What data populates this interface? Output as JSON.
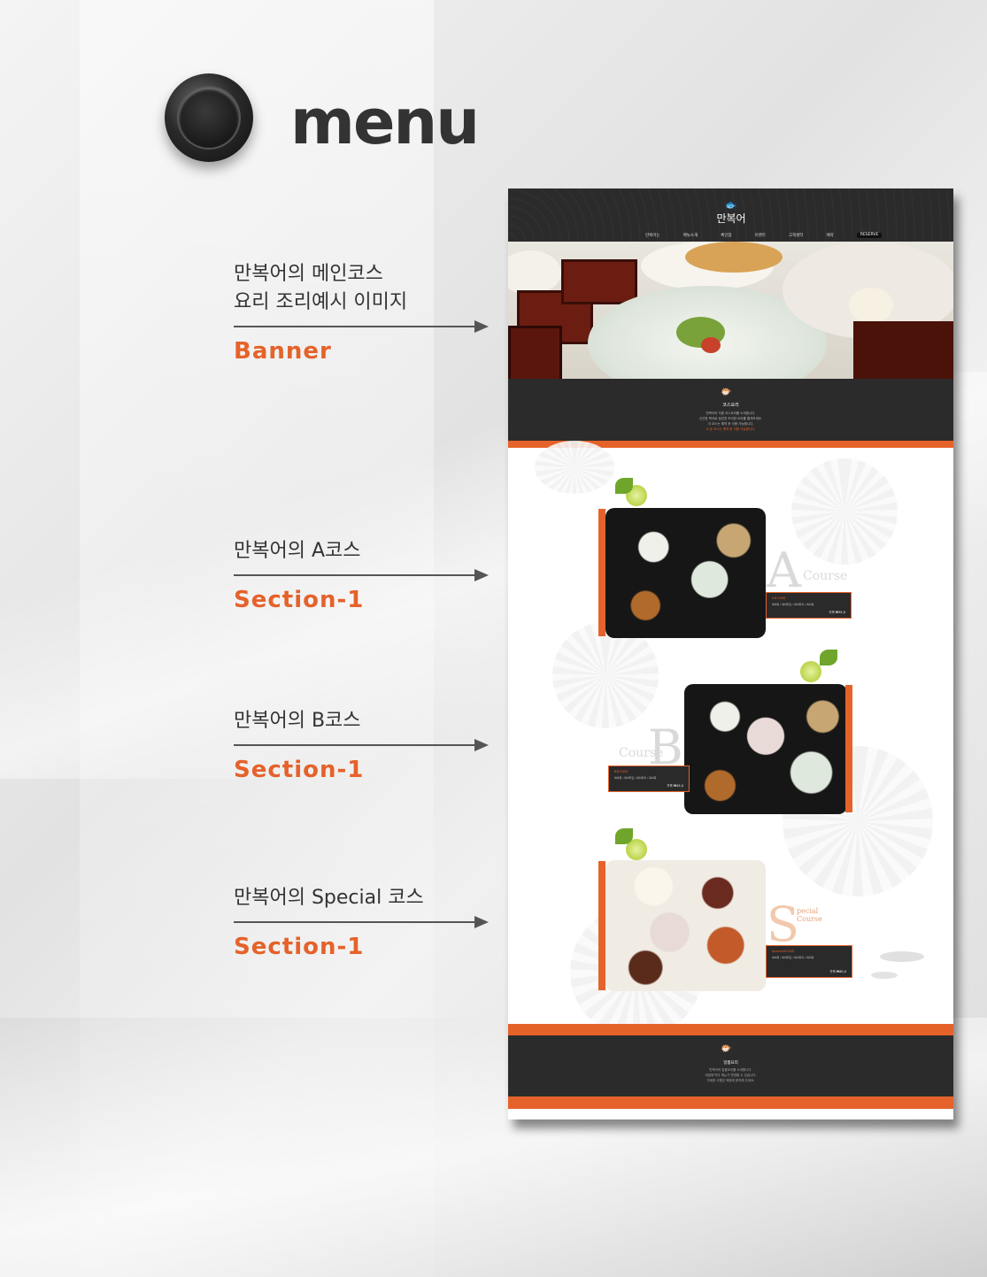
{
  "header": {
    "title": "menu"
  },
  "notes": [
    {
      "desc_lines": [
        "만복어의 메인코스",
        "요리 조리예시 이미지"
      ],
      "tag": "Banner"
    },
    {
      "desc_lines": [
        "만복어의 A코스"
      ],
      "tag": "Section-1"
    },
    {
      "desc_lines": [
        "만복어의 B코스"
      ],
      "tag": "Section-1"
    },
    {
      "desc_lines": [
        "만복어의 Special 코스"
      ],
      "tag": "Section-1"
    }
  ],
  "mockup": {
    "logo": "만복어",
    "nav": [
      "만복어는",
      "메뉴소개",
      "체인점",
      "이벤트",
      "고객센터",
      "예약",
      "RESERVE"
    ],
    "course_title": "코스요리",
    "course_text": [
      "만복어의 각종 코스요리를 소개합니다.",
      "신선한 복어로 정성껏 조리한 요리를 즐겨보세요.",
      "각 코스는 예약 후 이용 가능합니다."
    ],
    "course_note": "※ 본 코스는 예약 후 이용 가능합니다.",
    "sections": [
      {
        "letter": "A",
        "word": "Course",
        "label": "A코스요리",
        "info": "복어회 / 복어튀김 / 복어지리 / 복어죽",
        "price": "가격 ₩35,0"
      },
      {
        "letter": "B",
        "word": "Course",
        "label": "B코스요리",
        "info": "복어회 / 복어튀김 / 복어지리 / 복어죽",
        "price": "가격 ₩45,0"
      },
      {
        "letter": "S",
        "word": "pecial Course",
        "label": "Special코스요리",
        "info": "복어회 / 복어튀김 / 복어지리 / 복어죽",
        "price": "가격 ₩60,0"
      }
    ],
    "footer_title": "일품요리",
    "footer_text": [
      "만복어의 일품요리를 소개합니다.",
      "계절에 따라 메뉴가 변경될 수 있습니다.",
      "자세한 사항은 매장에 문의해 주세요."
    ]
  },
  "colors": {
    "accent": "#e5622a",
    "dark": "#2b2b2b",
    "text": "#333333",
    "background": "#ececec"
  }
}
